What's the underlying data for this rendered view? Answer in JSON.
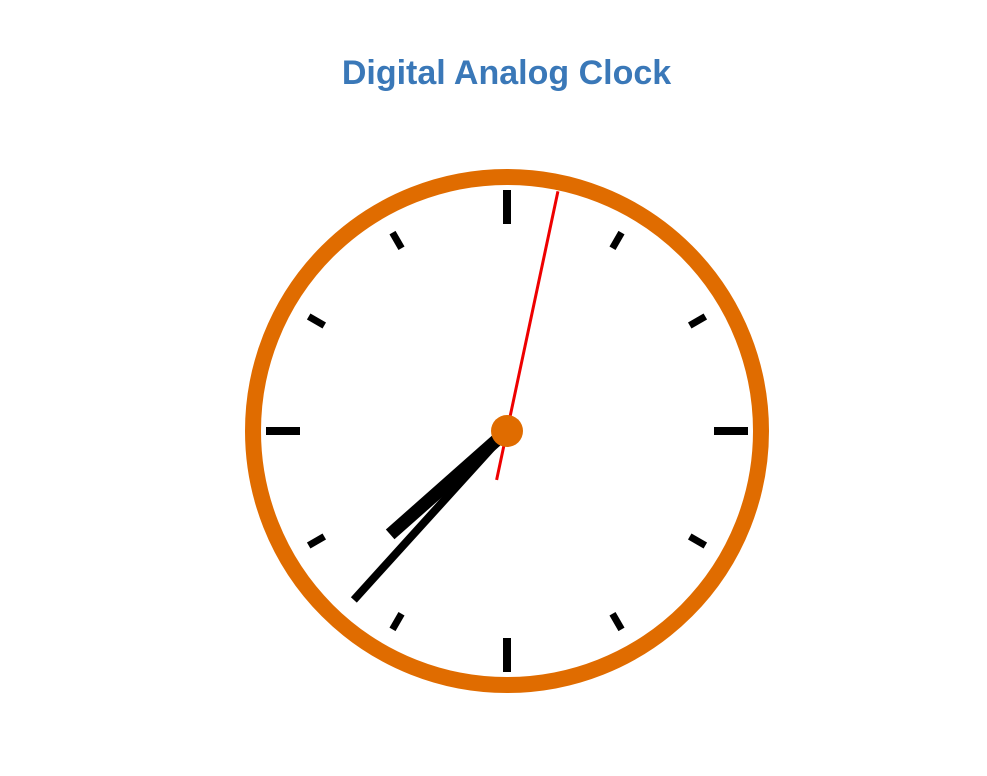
{
  "page": {
    "title": "Digital Analog Clock"
  },
  "clock": {
    "time": {
      "hour": 7,
      "minute": 37,
      "second": 2
    },
    "colors": {
      "rim": "#e06c00",
      "face": "#ffffff",
      "ticks": "#000000",
      "hands": "#000000",
      "second_hand": "#ee0000",
      "center_cap": "#e06c00",
      "title": "#3a78b8"
    }
  }
}
